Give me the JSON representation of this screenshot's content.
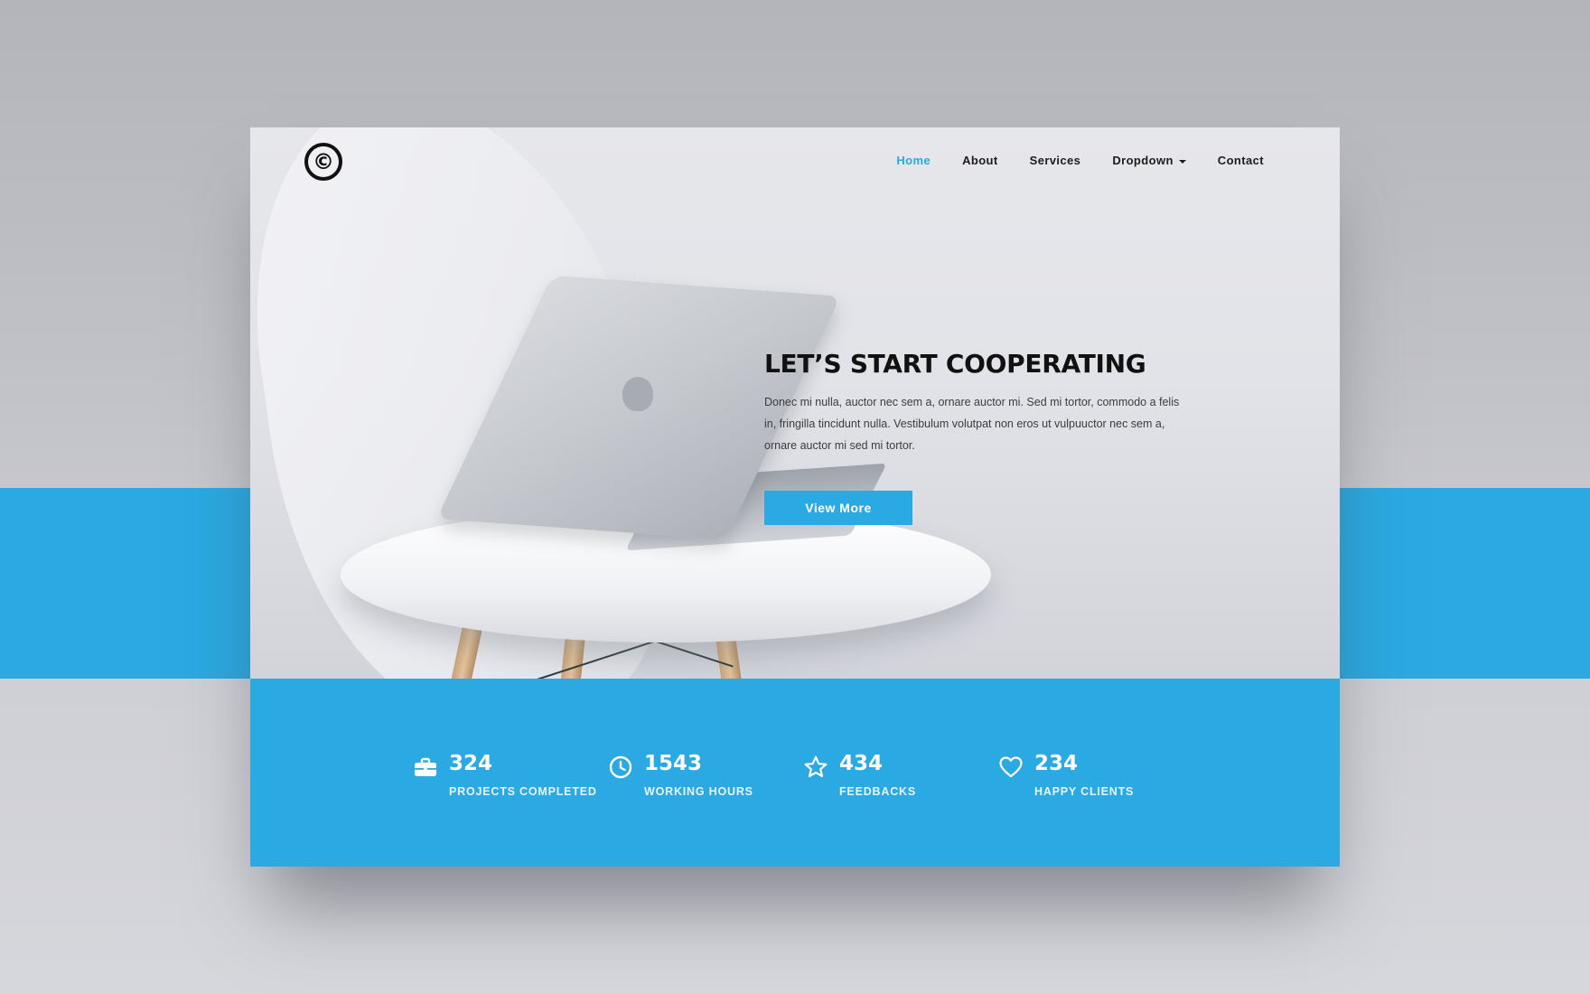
{
  "logo": {
    "glyph": "©"
  },
  "nav": {
    "items": [
      {
        "label": "Home",
        "active": true
      },
      {
        "label": "About"
      },
      {
        "label": "Services"
      },
      {
        "label": "Dropdown",
        "has_caret": true
      },
      {
        "label": "Contact"
      }
    ]
  },
  "hero": {
    "title": "LET’S START COOPERATING",
    "body": "Donec mi nulla, auctor nec sem a, ornare auctor mi. Sed mi tortor, commodo a felis in, fringilla tincidunt nulla. Vestibulum volutpat non eros ut vulpuuctor nec sem a, ornare auctor mi sed mi tortor.",
    "cta_label": "View More"
  },
  "stats": [
    {
      "icon": "briefcase-icon",
      "value": "324",
      "label": "PROJECTS COMPLETED"
    },
    {
      "icon": "clock-icon",
      "value": "1543",
      "label": "WORKING HOURS"
    },
    {
      "icon": "star-icon",
      "value": "434",
      "label": "FEEDBACKS"
    },
    {
      "icon": "heart-icon",
      "value": "234",
      "label": "HAPPY CLIENTS"
    }
  ],
  "colors": {
    "accent": "#2aa9e2",
    "text_dark": "#111111",
    "background_gray": "#c0c1c6"
  }
}
